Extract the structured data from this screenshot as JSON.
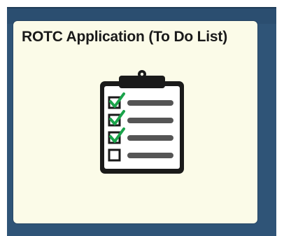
{
  "tile": {
    "title": "ROTC Application (To Do List)",
    "icon": "clipboard-checklist-icon",
    "checklist": [
      {
        "checked": true
      },
      {
        "checked": true
      },
      {
        "checked": true
      },
      {
        "checked": false
      }
    ]
  },
  "colors": {
    "frame": "#2f5477",
    "tile_background": "#fbfbe8",
    "check_mark": "#1aa34a",
    "clipboard": "#1a1a1a",
    "line": "#555555"
  }
}
